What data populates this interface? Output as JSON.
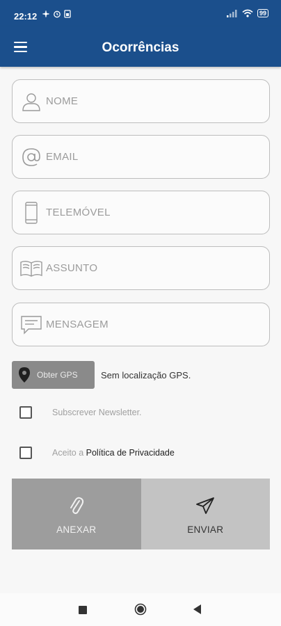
{
  "status_bar": {
    "time": "22:12",
    "battery": "99",
    "left_icons": [
      "fan-icon",
      "alarm-icon",
      "sim-icon"
    ],
    "right_icons": [
      "signal-icon",
      "wifi-icon",
      "battery-icon"
    ]
  },
  "app_bar": {
    "title": "Ocorrências",
    "menu_icon": "menu-icon"
  },
  "form": {
    "fields": [
      {
        "name": "name",
        "placeholder": "NOME",
        "icon": "person-icon"
      },
      {
        "name": "email",
        "placeholder": "EMAIL",
        "icon": "at-icon"
      },
      {
        "name": "phone",
        "placeholder": "TELEMÓVEL",
        "icon": "phone-icon"
      },
      {
        "name": "subject",
        "placeholder": "ASSUNTO",
        "icon": "book-icon"
      },
      {
        "name": "message",
        "placeholder": "MENSAGEM",
        "icon": "chat-icon"
      }
    ],
    "gps": {
      "button_label": "Obter GPS",
      "status": "Sem localização GPS."
    },
    "newsletter": {
      "label": "Subscrever Newsletter.",
      "checked": false
    },
    "privacy": {
      "prefix": "Aceito a ",
      "link": "Política de Privacidade",
      "checked": false
    }
  },
  "actions": {
    "attach_label": "ANEXAR",
    "send_label": "ENVIAR"
  },
  "colors": {
    "primary": "#1b4f8c",
    "attach_bg": "#9d9d9d",
    "send_bg": "#c3c3c3",
    "gps_bg": "#8a8a8a"
  }
}
